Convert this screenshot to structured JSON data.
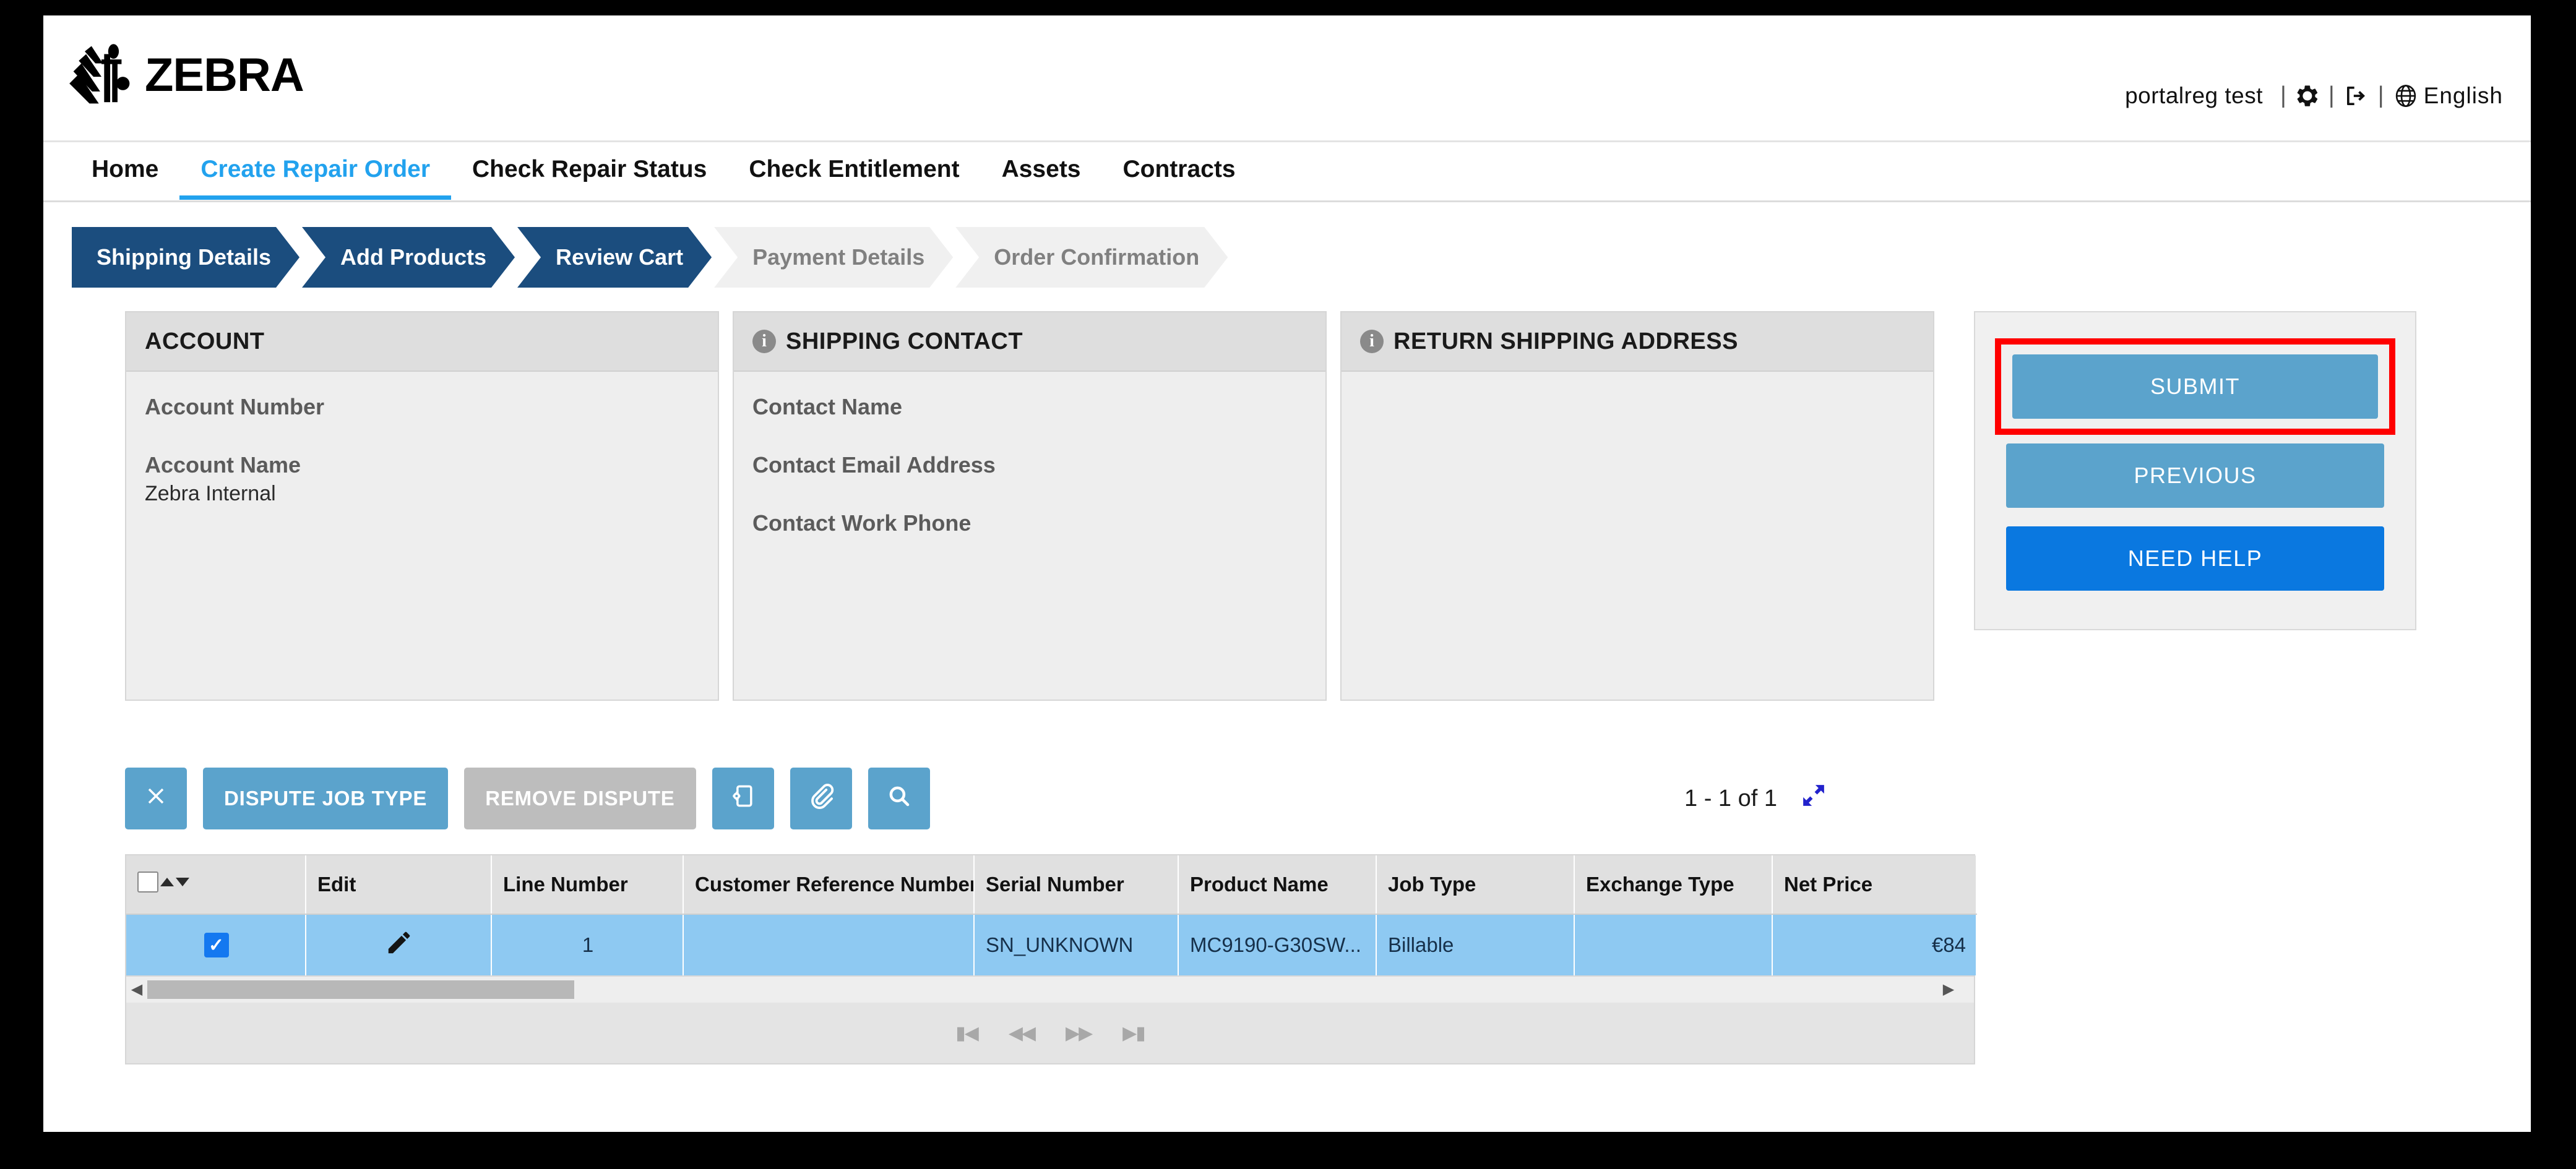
{
  "brand": {
    "name": "ZEBRA",
    "logo_icon": "zebra-stripes-logo"
  },
  "userbar": {
    "username": "portalreg test",
    "separator": "|",
    "settings_icon": "gear-icon",
    "logout_icon": "logout-icon",
    "globe_icon": "globe-icon",
    "language": "English"
  },
  "nav": {
    "items": [
      {
        "label": "Home",
        "active": false
      },
      {
        "label": "Create Repair Order",
        "active": true
      },
      {
        "label": "Check Repair Status",
        "active": false
      },
      {
        "label": "Check Entitlement",
        "active": false
      },
      {
        "label": "Assets",
        "active": false
      },
      {
        "label": "Contracts",
        "active": false
      }
    ]
  },
  "steps": [
    {
      "label": "Shipping Details",
      "state": "done"
    },
    {
      "label": "Add Products",
      "state": "done"
    },
    {
      "label": "Review Cart",
      "state": "current"
    },
    {
      "label": "Payment Details",
      "state": "pending"
    },
    {
      "label": "Order Confirmation",
      "state": "pending"
    }
  ],
  "panels": {
    "account": {
      "title": "ACCOUNT",
      "has_info_icon": false,
      "fields": [
        {
          "label": "Account Number",
          "value": ""
        },
        {
          "label": "Account Name",
          "value": "Zebra Internal"
        }
      ]
    },
    "shipping_contact": {
      "title": "SHIPPING CONTACT",
      "has_info_icon": true,
      "info_icon": "info-icon",
      "fields": [
        {
          "label": "Contact Name",
          "value": ""
        },
        {
          "label": "Contact Email Address",
          "value": ""
        },
        {
          "label": "Contact Work Phone",
          "value": ""
        }
      ]
    },
    "return_shipping_address": {
      "title": "RETURN SHIPPING ADDRESS",
      "has_info_icon": true,
      "info_icon": "info-icon",
      "fields": []
    }
  },
  "actions": {
    "submit_label": "SUBMIT",
    "previous_label": "PREVIOUS",
    "need_help_label": "NEED HELP",
    "highlight_color": "#ff0000",
    "steel_color": "#5ba3cc",
    "vivid_color": "#0a78e0",
    "highlighted_button": "SUBMIT"
  },
  "toolbar": {
    "close_icon": "close-x-icon",
    "dispute_job_type_label": "DISPUTE JOB TYPE",
    "remove_dispute_label": "REMOVE DISPUTE",
    "remove_dispute_disabled": true,
    "device_config_icon": "device-config-icon",
    "attachment_icon": "paperclip-icon",
    "search_icon": "search-icon",
    "record_count": "1 - 1 of 1",
    "expand_icon": "expand-diagonal-icon"
  },
  "table": {
    "columns": [
      "",
      "Edit",
      "Line Number",
      "Customer Reference Number",
      "Serial Number",
      "Product Name",
      "Job Type",
      "Exchange Type",
      "Net Price"
    ],
    "header_sort_up_icon": "caret-up-icon",
    "header_sort_down_icon": "caret-down-icon",
    "header_checkbox_checked": false,
    "rows": [
      {
        "selected": true,
        "edit_icon": "pencil-icon",
        "line_number": "1",
        "customer_reference_number": "",
        "serial_number": "SN_UNKNOWN",
        "product_name": "MC9190-G30SW...",
        "job_type": "Billable",
        "exchange_type": "",
        "net_price": "€84"
      }
    ],
    "pager": {
      "first_icon": "page-first-icon",
      "prev_icon": "page-prev-icon",
      "next_icon": "page-next-icon",
      "last_icon": "page-last-icon"
    },
    "scrollbar": {
      "left_arrow_icon": "scroll-left-icon",
      "right_arrow_icon": "scroll-right-icon"
    }
  }
}
